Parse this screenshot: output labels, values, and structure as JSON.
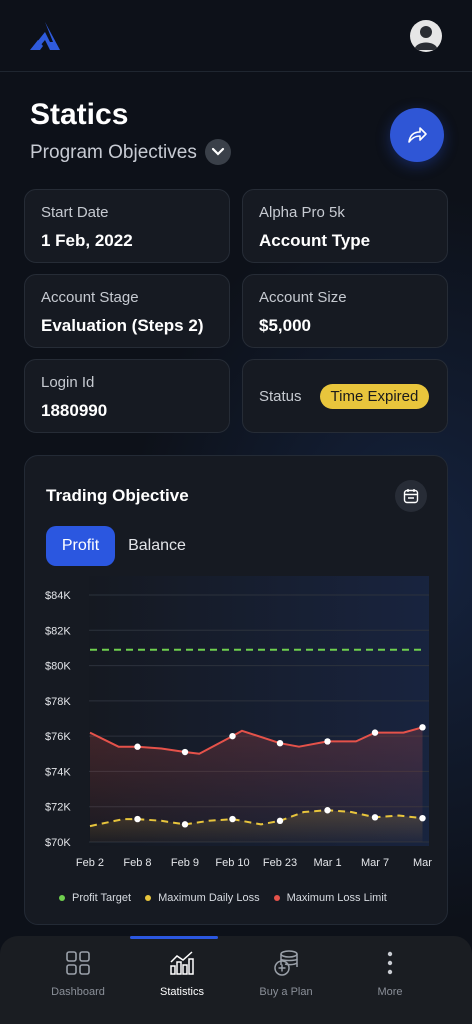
{
  "header": {
    "logo_icon": "brand-logo",
    "avatar_icon": "user-avatar-icon"
  },
  "page": {
    "title": "Statics",
    "subtitle": "Program Objectives",
    "dropdown_icon": "chevron-down-icon",
    "share_icon": "share-arrow-icon"
  },
  "cards": {
    "start_date": {
      "label": "Start Date",
      "value": "1 Feb, 2022"
    },
    "account_type": {
      "label": "Alpha Pro 5k",
      "value": "Account Type"
    },
    "account_stage": {
      "label": "Account Stage",
      "value": "Evaluation (Steps 2)"
    },
    "account_size": {
      "label": "Account Size",
      "value": "$5,000"
    },
    "login_id": {
      "label": "Login Id",
      "value": "1880990"
    },
    "status": {
      "label": "Status",
      "value": "Time Expired",
      "color": "#e8c53c"
    }
  },
  "trading": {
    "title": "Trading Objective",
    "calendar_icon": "calendar-icon",
    "tabs": [
      {
        "label": "Profit",
        "active": true
      },
      {
        "label": "Balance",
        "active": false
      }
    ]
  },
  "chart_data": {
    "type": "line",
    "x": [
      "Feb 2",
      "Feb 8",
      "Feb 9",
      "Feb 10",
      "Feb 23",
      "Mar 1",
      "Mar 7",
      "Mar"
    ],
    "y_ticks": [
      "$84K",
      "$82K",
      "$80K",
      "$78K",
      "$76K",
      "$74K",
      "$72K",
      "$70K"
    ],
    "ylim": [
      70000,
      84000
    ],
    "grid": true,
    "legend_position": "bottom",
    "series": [
      {
        "name": "Profit Target",
        "color": "#6fcf4e",
        "style": "dashed",
        "values": [
          [
            0,
            80900
          ],
          [
            7,
            80900
          ]
        ]
      },
      {
        "name": "Maximum Daily Loss",
        "color": "#e8c53c",
        "style": "dashed",
        "values": [
          [
            0,
            70900
          ],
          [
            0.7,
            71300
          ],
          [
            1,
            71300
          ],
          [
            1.5,
            71200
          ],
          [
            2,
            71000
          ],
          [
            2.5,
            71200
          ],
          [
            3,
            71300
          ],
          [
            3.6,
            71000
          ],
          [
            4,
            71200
          ],
          [
            4.5,
            71700
          ],
          [
            5,
            71800
          ],
          [
            5.5,
            71700
          ],
          [
            6,
            71400
          ],
          [
            6.5,
            71500
          ],
          [
            7,
            71350
          ]
        ],
        "markers": [
          [
            1,
            71300
          ],
          [
            2,
            71000
          ],
          [
            3,
            71300
          ],
          [
            4,
            71200
          ],
          [
            5,
            71800
          ],
          [
            6,
            71400
          ],
          [
            7,
            71350
          ]
        ]
      },
      {
        "name": "Maximum Loss Limit",
        "color": "#e5524a",
        "style": "solid",
        "values": [
          [
            0,
            76200
          ],
          [
            0.6,
            75400
          ],
          [
            1,
            75400
          ],
          [
            1.5,
            75300
          ],
          [
            2,
            75100
          ],
          [
            2.3,
            75000
          ],
          [
            3,
            76000
          ],
          [
            3.2,
            76300
          ],
          [
            4,
            75600
          ],
          [
            4.4,
            75400
          ],
          [
            5,
            75700
          ],
          [
            5.6,
            75700
          ],
          [
            6,
            76200
          ],
          [
            6.6,
            76200
          ],
          [
            7,
            76500
          ]
        ],
        "markers": [
          [
            1,
            75400
          ],
          [
            2,
            75100
          ],
          [
            3,
            76000
          ],
          [
            4,
            75600
          ],
          [
            5,
            75700
          ],
          [
            6,
            76200
          ],
          [
            7,
            76500
          ]
        ]
      }
    ]
  },
  "nav": [
    {
      "label": "Dashboard",
      "icon": "dashboard-grid-icon",
      "active": false
    },
    {
      "label": "Statistics",
      "icon": "statistics-chart-icon",
      "active": true
    },
    {
      "label": "Buy a Plan",
      "icon": "coins-plus-icon",
      "active": false
    },
    {
      "label": "More",
      "icon": "more-vertical-icon",
      "active": false
    }
  ]
}
